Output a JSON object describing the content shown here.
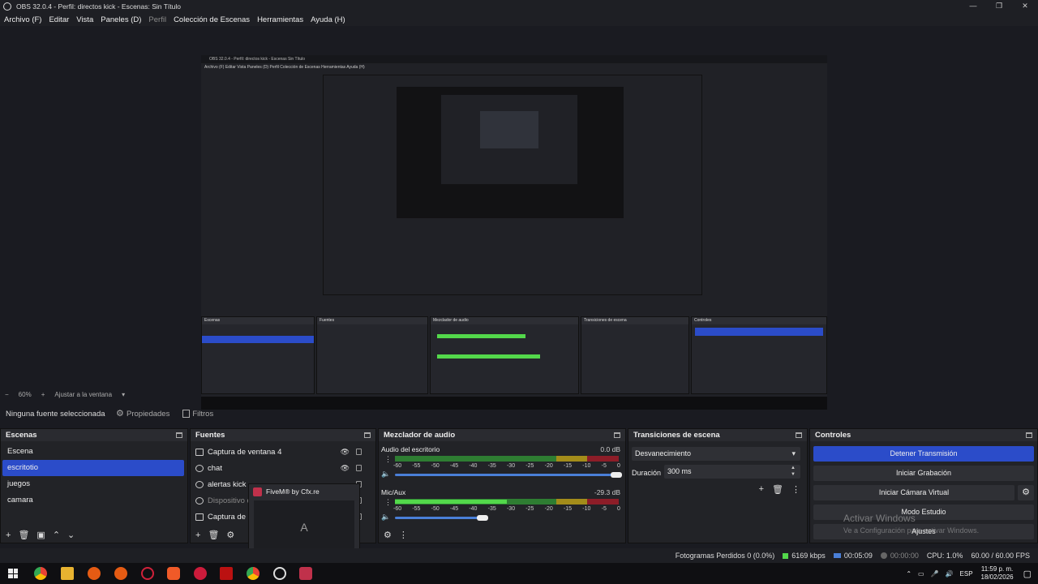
{
  "window": {
    "title": "OBS 32.0.4 - Perfil: directos kick - Escenas: Sin Título",
    "min": "—",
    "max": "❐",
    "close": "✕"
  },
  "menu": [
    "Archivo (F)",
    "Editar",
    "Vista",
    "Paneles (D)",
    "Perfil",
    "Colección de Escenas",
    "Herramientas",
    "Ayuda (H)"
  ],
  "preview": {
    "inner_title": "OBS 32.0.4 - Perfil: directos kick - Escenas Sin Título",
    "inner_menu": "Archivo (F)   Editar   Vista   Paneles (D)   Perfil   Colección de Escenas   Herramientas   Ayuda (H)"
  },
  "zoom": {
    "minus": "−",
    "level": "60%",
    "plus": "+",
    "fit": "Ajustar a la ventana",
    "caret": "▾"
  },
  "propbar": {
    "no_selection": "Ninguna fuente seleccionada",
    "properties": "Propiedades",
    "filters": "Filtros"
  },
  "scenes": {
    "title": "Escenas",
    "items": [
      "Escena",
      "escritotio",
      "juegos",
      "camara"
    ],
    "footer": [
      "+",
      "🗑",
      "▣",
      "⌃",
      "⌄"
    ]
  },
  "sources": {
    "title": "Fuentes",
    "items": [
      "Captura de ventana 4",
      "chat",
      "alertas kick",
      "Dispositivo d",
      "Captura de p"
    ],
    "footer": [
      "+",
      "🗑",
      "⚙"
    ]
  },
  "popup": {
    "title": "FiveM® by Cfx.re",
    "thumb": "A"
  },
  "mixer": {
    "title": "Mezclador de audio",
    "channels": [
      {
        "name": "Audio del escritorio",
        "db": "0.0 dB",
        "level": 0.0,
        "volume": 1.0
      },
      {
        "name": "Mic/Aux",
        "db": "-29.3 dB",
        "level": 0.5,
        "volume": 0.38
      }
    ],
    "scale": [
      "-60",
      "-55",
      "-50",
      "-45",
      "-40",
      "-35",
      "-30",
      "-25",
      "-20",
      "-15",
      "-10",
      "-5",
      "0"
    ]
  },
  "transitions": {
    "title": "Transiciones de escena",
    "selected": "Desvanecimiento",
    "duration_label": "Duración",
    "duration_value": "300 ms"
  },
  "controls": {
    "title": "Controles",
    "stop_stream": "Detener Transmisión",
    "start_recording": "Iniciar Grabación",
    "virtual_cam": "Iniciar Cámara Virtual",
    "studio_mode": "Modo Estudio",
    "settings": "Ajustes"
  },
  "watermark": {
    "line1": "Activar Windows",
    "line2": "Ve a Configuración para activar Windows."
  },
  "status": {
    "dropped": "Fotogramas Perdidos 0 (0.0%)",
    "bitrate": "6169 kbps",
    "stream_time": "00:05:09",
    "rec_time": "00:00:00",
    "cpu": "CPU: 1.0%",
    "fps": "60.00 / 60.00 FPS"
  },
  "taskbar": {
    "time": "11:59 p. m.",
    "date": "18/02/2026",
    "lang": "ESP"
  },
  "colors": {
    "accent": "#2b4cc9",
    "meter_green": "#53d84b",
    "meter_yellow": "#a38c1a",
    "meter_red": "#8d1d28"
  }
}
